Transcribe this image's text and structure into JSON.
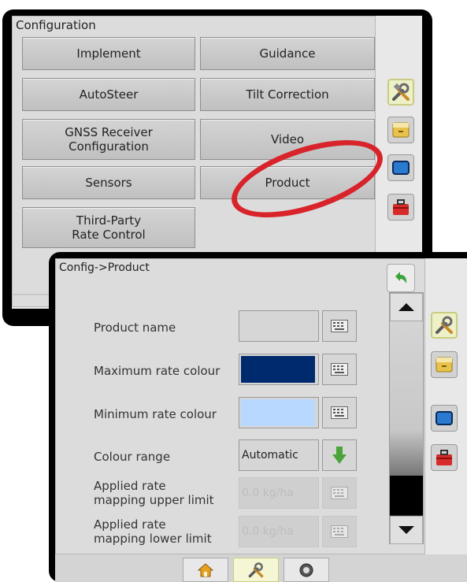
{
  "config_panel": {
    "title": "Configuration",
    "buttons": [
      {
        "label": "Implement"
      },
      {
        "label": "Guidance"
      },
      {
        "label": "AutoSteer"
      },
      {
        "label": "Tilt Correction"
      },
      {
        "label": "GNSS Receiver\nConfiguration"
      },
      {
        "label": "Video"
      },
      {
        "label": "Sensors"
      },
      {
        "label": "Product"
      },
      {
        "label": "Third-Party\nRate Control"
      }
    ],
    "highlight": "Product",
    "side_icons": [
      "tools-icon",
      "folder-icon",
      "screen-icon",
      "toolbox-icon"
    ]
  },
  "product_panel": {
    "title": "Config->Product",
    "rows": [
      {
        "label": "Product name",
        "value": ""
      },
      {
        "label": "Maximum rate colour",
        "color": "#002a6e"
      },
      {
        "label": "Minimum rate colour",
        "color": "#b9d8ff"
      },
      {
        "label": "Colour range",
        "value": "Automatic"
      },
      {
        "label": "Applied rate\nmapping upper limit",
        "value": "0.0 kg/ha"
      },
      {
        "label": "Applied rate\nmapping lower limit",
        "value": "0.0 kg/ha"
      }
    ],
    "tabs": [
      "home-icon",
      "tools-icon",
      "gauge-icon"
    ]
  }
}
